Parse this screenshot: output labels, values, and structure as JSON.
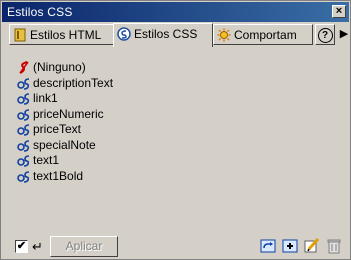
{
  "panel": {
    "title": "Estilos CSS",
    "close_label": "×"
  },
  "tabs": [
    {
      "label": "Estilos HTML",
      "icon": "html-styles-icon",
      "active": false
    },
    {
      "label": "Estilos CSS",
      "icon": "css-styles-icon",
      "active": true
    },
    {
      "label": "Comportam",
      "icon": "behaviors-icon",
      "active": false
    }
  ],
  "help_label": "?",
  "menu_arrow": "▶",
  "styles": [
    {
      "label": "(Ninguno)",
      "icon": "no-style-icon"
    },
    {
      "label": "descriptionText",
      "icon": "css-style-icon"
    },
    {
      "label": "link1",
      "icon": "css-style-icon"
    },
    {
      "label": "priceNumeric",
      "icon": "css-style-icon"
    },
    {
      "label": "priceText",
      "icon": "css-style-icon"
    },
    {
      "label": "specialNote",
      "icon": "css-style-icon"
    },
    {
      "label": "text1",
      "icon": "css-style-icon"
    },
    {
      "label": "text1Bold",
      "icon": "css-style-icon"
    }
  ],
  "footer": {
    "apply_mode_checked": true,
    "checkmark": "✔",
    "enter_glyph": "↵",
    "apply_label": "Aplicar",
    "buttons": [
      "attach-stylesheet-icon",
      "new-style-icon",
      "edit-style-icon",
      "delete-style-icon"
    ]
  },
  "colors": {
    "titlebar": "#0a246a",
    "panel_bg": "#d4d0c8"
  }
}
